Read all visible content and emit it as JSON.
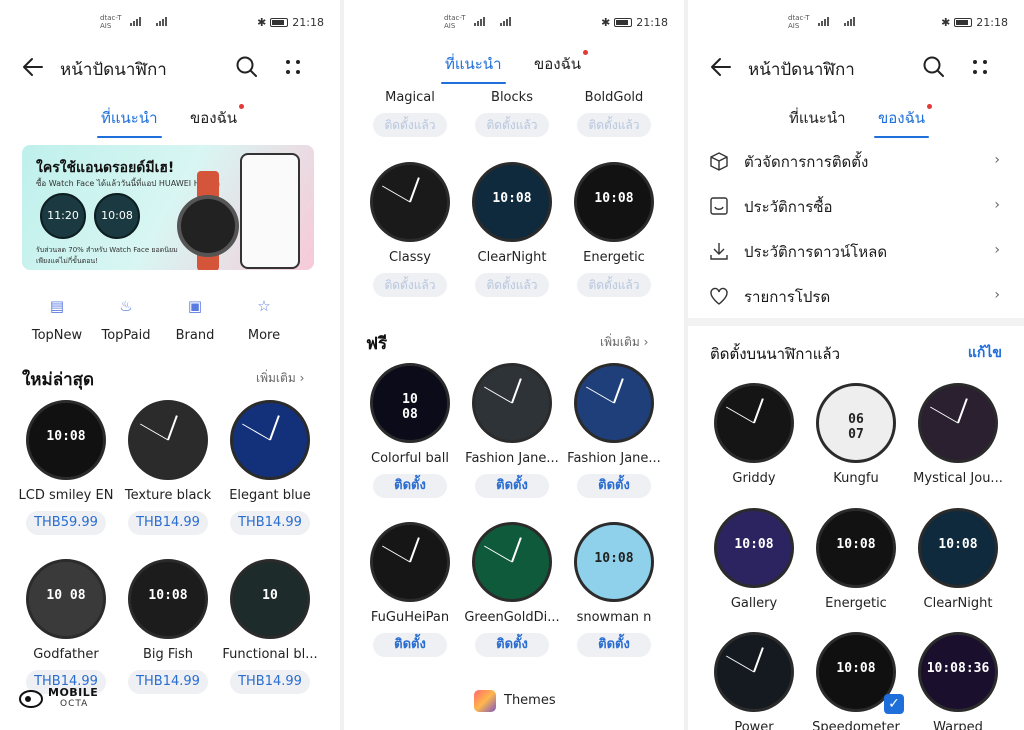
{
  "status": {
    "carrier": "dtac-T\nAIS",
    "network": "4G",
    "time": "21:18"
  },
  "left": {
    "title": "หน้าปัดนาฬิกา",
    "tabs": [
      {
        "label": "ที่แนะนำ",
        "active": true
      },
      {
        "label": "ของฉัน",
        "active": false,
        "dot": true
      }
    ],
    "banner": {
      "title": "ใครใช้แอนดรอยด์มีเฮ!",
      "subtitle": "ซื้อ Watch Face ได้แล้ววันนี้ที่แอป HUAWEI Health",
      "w1": "11:20",
      "w2": "10:08",
      "footer": "รับส่วนลด 70% สำหรับ Watch Face ยอดนิยม\nเพียงแค่ไม่กี่ขั้นตอน!"
    },
    "categories": [
      {
        "label": "TopNew",
        "icon": "topnew-icon"
      },
      {
        "label": "TopPaid",
        "icon": "toppaid-icon"
      },
      {
        "label": "Brand",
        "icon": "brand-icon"
      },
      {
        "label": "More",
        "icon": "more-star-icon"
      }
    ],
    "section_title": "ใหม่ล่าสุด",
    "section_more": "เพิ่มเติม",
    "items": [
      {
        "name": "LCD smiley EN",
        "price": "THB59.99",
        "face_text": "10:08",
        "bg": "#111111"
      },
      {
        "name": "Texture black",
        "price": "THB14.99",
        "face_text": "",
        "bg": "#2b2b2b"
      },
      {
        "name": "Elegant blue",
        "price": "THB14.99",
        "face_text": "",
        "bg": "#13307a"
      },
      {
        "name": "Godfather",
        "price": "THB14.99",
        "face_text": "10 08",
        "bg": "#3a3a3a"
      },
      {
        "name": "Big Fish",
        "price": "THB14.99",
        "face_text": "10:08",
        "bg": "#1c1c1c"
      },
      {
        "name": "Functional bl...",
        "price": "THB14.99",
        "face_text": "10",
        "bg": "#1d2b2b"
      }
    ],
    "watermark": {
      "line1": "MOBILE",
      "line2": "OCTA"
    }
  },
  "middle": {
    "tabs": [
      {
        "label": "ที่แนะนำ",
        "active": true
      },
      {
        "label": "ของฉัน",
        "active": false,
        "dot": true
      }
    ],
    "top_items": [
      {
        "name": "Magical",
        "status": "ติดตั้งแล้ว"
      },
      {
        "name": "Blocks",
        "status": "ติดตั้งแล้ว"
      },
      {
        "name": "BoldGold",
        "status": "ติดตั้งแล้ว"
      },
      {
        "name": "Classy",
        "status": "ติดตั้งแล้ว",
        "face_text": "",
        "bg": "#1a1a1a"
      },
      {
        "name": "ClearNight",
        "status": "ติดตั้งแล้ว",
        "face_text": "10:08",
        "bg": "#0f2a3c"
      },
      {
        "name": "Energetic",
        "status": "ติดตั้งแล้ว",
        "face_text": "10:08",
        "bg": "#121212"
      }
    ],
    "section_title": "ฟรี",
    "section_more": "เพิ่มเติม",
    "free_items": [
      {
        "name": "Colorful ball",
        "status": "ติดตั้ง",
        "face_text": "10\n08",
        "bg": "#0b0b1a"
      },
      {
        "name": "Fashion Jane...",
        "status": "ติดตั้ง",
        "face_text": "",
        "bg": "#2e3338"
      },
      {
        "name": "Fashion Jane...",
        "status": "ติดตั้ง",
        "face_text": "",
        "bg": "#1f3f7a"
      },
      {
        "name": "FuGuHeiPan",
        "status": "ติดตั้ง",
        "face_text": "",
        "bg": "#161616"
      },
      {
        "name": "GreenGoldDi...",
        "status": "ติดตั้ง",
        "face_text": "",
        "bg": "#0f5a3a"
      },
      {
        "name": "snowman n",
        "status": "ติดตั้ง",
        "face_text": "10:08",
        "bg": "#8fd1ea"
      }
    ],
    "footer": {
      "label": "Themes"
    }
  },
  "right": {
    "title": "หน้าปัดนาฬิกา",
    "tabs": [
      {
        "label": "ที่แนะนำ",
        "active": false
      },
      {
        "label": "ของฉัน",
        "active": true,
        "dot": true
      }
    ],
    "menu": [
      {
        "label": "ตัวจัดการการติดตั้ง",
        "icon": "box-icon"
      },
      {
        "label": "ประวัติการซื้อ",
        "icon": "purchase-icon"
      },
      {
        "label": "ประวัติการดาวน์โหลด",
        "icon": "download-icon"
      },
      {
        "label": "รายการโปรด",
        "icon": "heart-icon"
      }
    ],
    "installed_title": "ติดตั้งบนนาฬิกาแล้ว",
    "edit_label": "แก้ไข",
    "installed": [
      {
        "name": "Griddy",
        "face_text": "",
        "bg": "#151515"
      },
      {
        "name": "Kungfu",
        "face_text": "06\n07",
        "bg": "#eeeeee"
      },
      {
        "name": "Mystical Jou...",
        "face_text": "",
        "bg": "#2a2030"
      },
      {
        "name": "Gallery",
        "face_text": "10:08",
        "bg": "#2c2460"
      },
      {
        "name": "Energetic",
        "face_text": "10:08",
        "bg": "#121212"
      },
      {
        "name": "ClearNight",
        "face_text": "10:08",
        "bg": "#0f2a3c"
      },
      {
        "name": "Power",
        "face_text": "",
        "bg": "#141a1f",
        "selected": false
      },
      {
        "name": "Speedometer",
        "face_text": "10:08",
        "bg": "#101010",
        "selected": true
      },
      {
        "name": "Warped",
        "face_text": "10:08:36",
        "bg": "#1b0f2e",
        "selected": false
      }
    ]
  },
  "colors": {
    "accent": "#1e6fd9",
    "badge": "#e53935",
    "pill_bg": "#eef0f4"
  }
}
